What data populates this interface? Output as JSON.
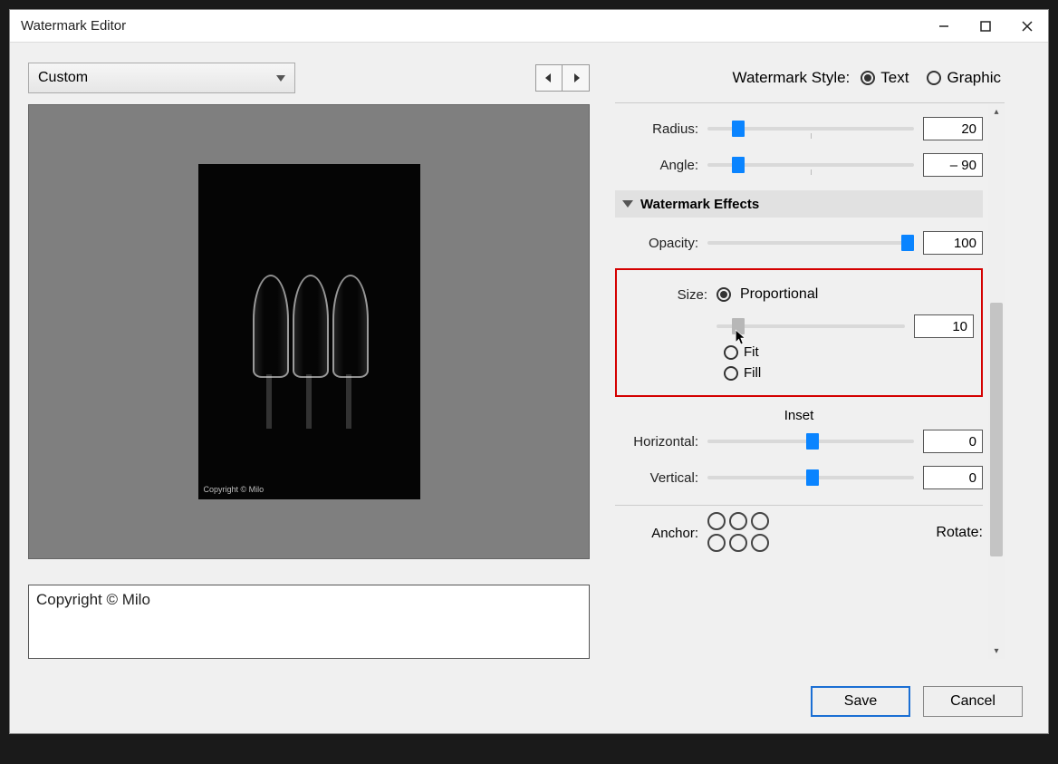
{
  "window": {
    "title": "Watermark Editor"
  },
  "preset": {
    "selected": "Custom"
  },
  "watermark_text": "Copyright © Milo",
  "preview_overlay": "Copyright © Milo",
  "style": {
    "label": "Watermark Style:",
    "text_label": "Text",
    "graphic_label": "Graphic",
    "selected": "text"
  },
  "sliders": {
    "radius": {
      "label": "Radius:",
      "value": "20",
      "pos": 12
    },
    "angle": {
      "label": "Angle:",
      "value": "– 90",
      "pos": 12
    },
    "opacity": {
      "label": "Opacity:",
      "value": "100",
      "pos": 100
    },
    "size": {
      "value": "10",
      "pos": 8
    },
    "inset_h": {
      "label": "Horizontal:",
      "value": "0",
      "pos": 50
    },
    "inset_v": {
      "label": "Vertical:",
      "value": "0",
      "pos": 50
    }
  },
  "effects_header": "Watermark Effects",
  "size": {
    "label": "Size:",
    "proportional": "Proportional",
    "fit": "Fit",
    "fill": "Fill",
    "selected": "proportional"
  },
  "inset_label": "Inset",
  "anchor_label": "Anchor:",
  "rotate_label": "Rotate:",
  "buttons": {
    "save": "Save",
    "cancel": "Cancel"
  }
}
